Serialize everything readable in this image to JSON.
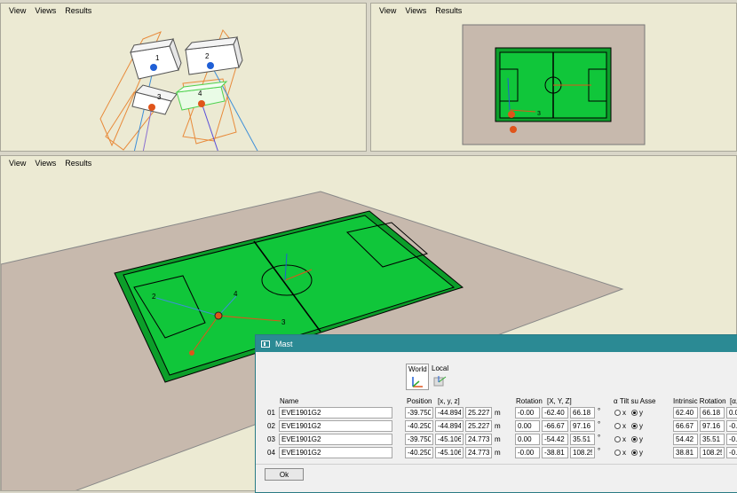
{
  "menus": {
    "top_left": [
      "View",
      "Views",
      "Results"
    ],
    "top_right": [
      "View",
      "Views",
      "Results"
    ],
    "main": [
      "View",
      "Views",
      "Results"
    ]
  },
  "camera_labels": [
    "1",
    "2",
    "3",
    "4"
  ],
  "main_view_labels": [
    "2",
    "4",
    "3"
  ],
  "dialog": {
    "title": "Mast",
    "world_label": "World",
    "local_label": "Local",
    "headers": {
      "name": "Name",
      "position": "Position",
      "position_axes": "[x, y, z]",
      "rotation": "Rotation",
      "rotation_axes": "[X, Y, Z]",
      "tilt": "α Tilt su Asse",
      "intrinsic": "Intrinsic Rotation",
      "intrinsic_axes": "[α,"
    },
    "unit_m": "m",
    "unit_deg": "°",
    "radio_x": "x",
    "radio_y": "y",
    "rows": [
      {
        "num": "01",
        "name": "EVE1901G2",
        "px": "-39.750",
        "py": "-44.894",
        "pz": "25.227",
        "rx": "-0.00",
        "ry": "-62.40",
        "rz": "66.18",
        "ia": "62.40",
        "ib": "66.18",
        "ic": "0.0"
      },
      {
        "num": "02",
        "name": "EVE1901G2",
        "px": "-40.250",
        "py": "-44.894",
        "pz": "25.227",
        "rx": "0.00",
        "ry": "-66.67",
        "rz": "97.16",
        "ia": "66.67",
        "ib": "97.16",
        "ic": "-0."
      },
      {
        "num": "03",
        "name": "EVE1901G2",
        "px": "-39.750",
        "py": "-45.106",
        "pz": "24.773",
        "rx": "0.00",
        "ry": "-54.42",
        "rz": "35.51",
        "ia": "54.42",
        "ib": "35.51",
        "ic": "-0."
      },
      {
        "num": "04",
        "name": "EVE1901G2",
        "px": "-40.250",
        "py": "-45.106",
        "pz": "24.773",
        "rx": "-0.00",
        "ry": "-38.81",
        "rz": "108.25",
        "ia": "38.81",
        "ib": "108.25",
        "ic": "-0."
      }
    ],
    "ok_label": "Ok"
  },
  "colors": {
    "pitch_green": "#10c63a",
    "pitch_dark": "#0c9e2a",
    "surround": "#c7b9ad",
    "camera_blue": "#1f5fd6",
    "camera_orange": "#e0541a",
    "frustum_orange": "#e88a3a",
    "dialog_title": "#2b8a94"
  }
}
